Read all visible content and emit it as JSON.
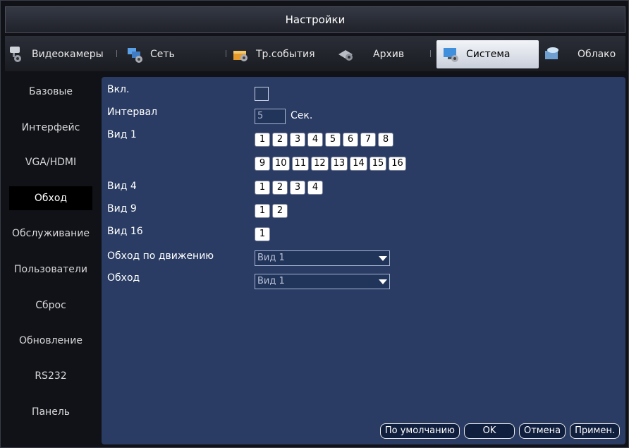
{
  "window": {
    "title": "Настройки"
  },
  "tabs": [
    {
      "label": "Видеокамеры",
      "icon": "camera-icon",
      "active": false
    },
    {
      "label": "Сеть",
      "icon": "network-icon",
      "active": false
    },
    {
      "label": "Тр.события",
      "icon": "events-icon",
      "active": false
    },
    {
      "label": "Архив",
      "icon": "storage-icon",
      "active": false
    },
    {
      "label": "Система",
      "icon": "system-icon",
      "active": true
    },
    {
      "label": "Облако",
      "icon": "cloud-icon",
      "active": false
    }
  ],
  "sidebar": {
    "items": [
      "Базовые",
      "Интерфейс",
      "VGA/HDMI",
      "Обход",
      "Обслуживание",
      "Пользователи",
      "Сброс",
      "Обновление",
      "RS232",
      "Панель"
    ],
    "active_index": 3
  },
  "form": {
    "enable_label": "Вкл.",
    "interval_label": "Интервал",
    "interval_value": "5",
    "interval_unit": "Сек.",
    "view1_label": "Вид 1",
    "view1_row1": [
      "1",
      "2",
      "3",
      "4",
      "5",
      "6",
      "7",
      "8"
    ],
    "view1_row2": [
      "9",
      "10",
      "11",
      "12",
      "13",
      "14",
      "15",
      "16"
    ],
    "view4_label": "Вид 4",
    "view4_buttons": [
      "1",
      "2",
      "3",
      "4"
    ],
    "view9_label": "Вид 9",
    "view9_buttons": [
      "1",
      "2"
    ],
    "view16_label": "Вид 16",
    "view16_buttons": [
      "1"
    ],
    "motion_tour_label": "Обход по движению",
    "motion_tour_value": "Вид 1",
    "tour_label": "Обход",
    "tour_value": "Вид 1"
  },
  "buttons": {
    "default": "По умолчанию",
    "ok": "OK",
    "cancel": "Отмена",
    "apply": "Примен."
  },
  "colors": {
    "panel": "#2a3c63",
    "active_tab": "#dfe4ee"
  }
}
